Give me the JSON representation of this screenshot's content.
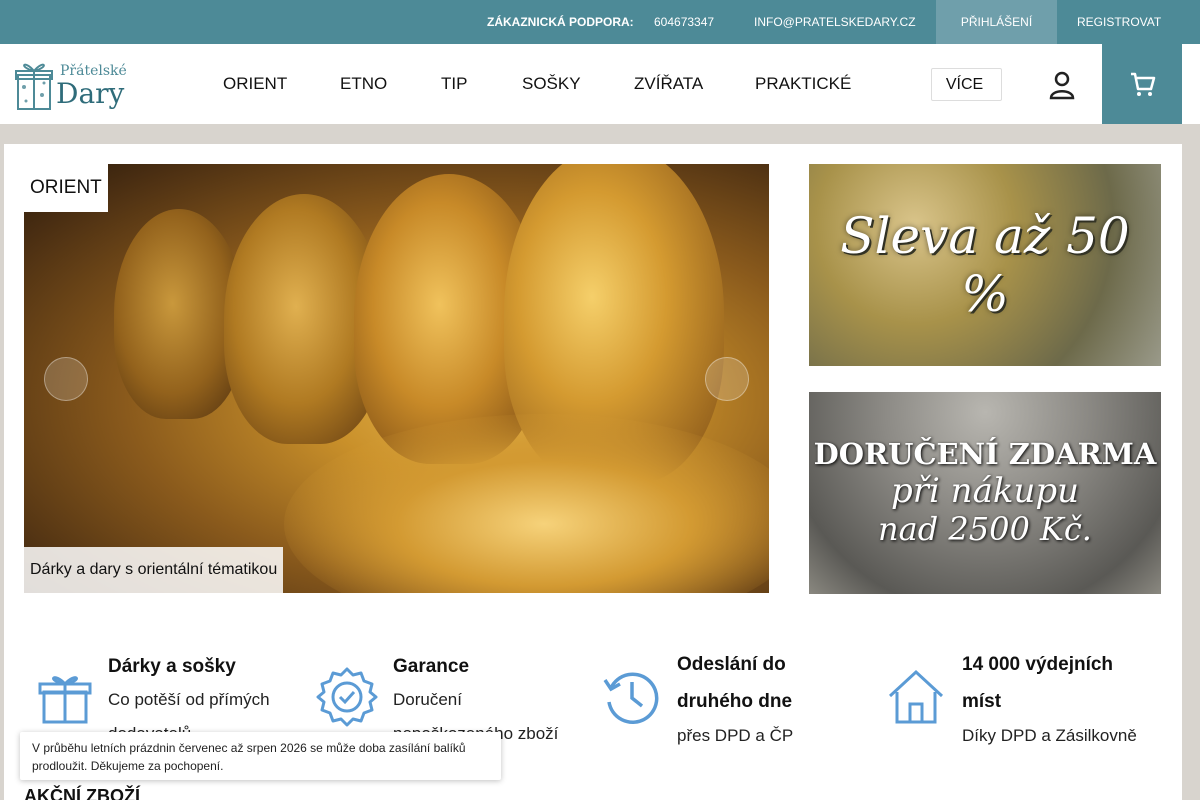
{
  "topbar": {
    "support_label": "ZÁKAZNICKÁ PODPORA:",
    "phone": "604673347",
    "email": "INFO@PRATELSKEDARY.CZ",
    "login": "PŘIHLÁŠENÍ",
    "login_icon": "",
    "register": "REGISTROVAT"
  },
  "header": {
    "logo_small": "Přátelské",
    "logo_big": "Dary",
    "nav": [
      {
        "label": "ORIENT"
      },
      {
        "label": "ETNO"
      },
      {
        "label": "TIP"
      },
      {
        "label": "SOŠKY"
      },
      {
        "label": "ZVÍŘATA"
      },
      {
        "label": "PRAKTICKÉ"
      }
    ],
    "more": "VÍCE",
    "chevron": "",
    "user_icon": "user-icon",
    "cart_icon": "cart-icon"
  },
  "slider": {
    "tag": "ORIENT",
    "caption": "Dárky a dary s orientální tématikou",
    "prev": "",
    "next": ""
  },
  "banners": {
    "sale": "Sleva až 50 %",
    "shipping": [
      "DORUČENÍ ZDARMA",
      "při nákupu",
      "nad 2500 Kč."
    ]
  },
  "features": [
    {
      "title": "Dárky a sošky",
      "sub": "Co potěší od přímých dodavatelů",
      "icon": "gift-icon"
    },
    {
      "title": "Garance",
      "sub": "Doručení nepoškozeného zboží",
      "icon": "badge-check-icon"
    },
    {
      "title": "Odeslání do druhého dne",
      "sub": "přes DPD a ČP",
      "icon": "clock-history-icon"
    },
    {
      "title": "14 000 výdejních míst",
      "sub": "Díky DPD a Zásilkovně",
      "icon": "home-icon"
    }
  ],
  "section_title": "AKČNÍ ZBOŽÍ",
  "notice": {
    "text": "V průběhu letních prázdnin červenec až srpen 2026 se může doba zasílání balíků prodloužit. Děkujeme za pochopení.",
    "close": ""
  },
  "colors": {
    "brand": "#4d8a97",
    "brand_light": "#6f9fab",
    "icon_blue": "#5b9bd5"
  }
}
